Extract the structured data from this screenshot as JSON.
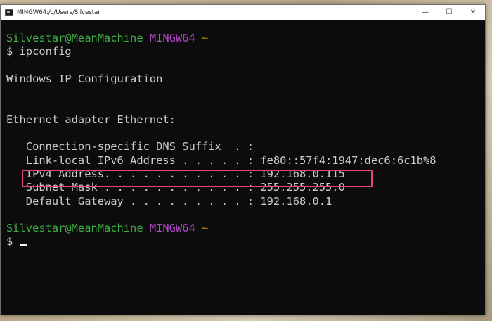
{
  "window": {
    "title": "MINGW64:/c/Users/Silvestar",
    "controls": {
      "minimize": "—",
      "maximize": "☐",
      "close": "✕"
    }
  },
  "terminal": {
    "prompt1": {
      "user_host": "Silvestar@MeanMachine",
      "env": "MINGW64",
      "path": "~"
    },
    "command": "$ ipconfig",
    "header": "Windows IP Configuration",
    "adapter": "Ethernet adapter Ethernet:",
    "entries": [
      {
        "label": "   Connection-specific DNS Suffix  . :",
        "value": ""
      },
      {
        "label": "   Link-local IPv6 Address . . . . . :",
        "value": " fe80::57f4:1947:dec6:6c1b%8"
      },
      {
        "label": "   IPv4 Address. . . . . . . . . . . :",
        "value": " 192.168.0.115"
      },
      {
        "label": "   Subnet Mask . . . . . . . . . . . :",
        "value": " 255.255.255.0"
      },
      {
        "label": "   Default Gateway . . . . . . . . . :",
        "value": " 192.168.0.1"
      }
    ],
    "prompt2": {
      "user_host": "Silvestar@MeanMachine",
      "env": "MINGW64",
      "path": "~"
    },
    "prompt_symbol": "$ "
  },
  "colors": {
    "user_host": "#3cb043",
    "env": "#b148c6",
    "path": "#c19c00",
    "highlight": "#e0457b",
    "background": "#0c0c0c"
  }
}
